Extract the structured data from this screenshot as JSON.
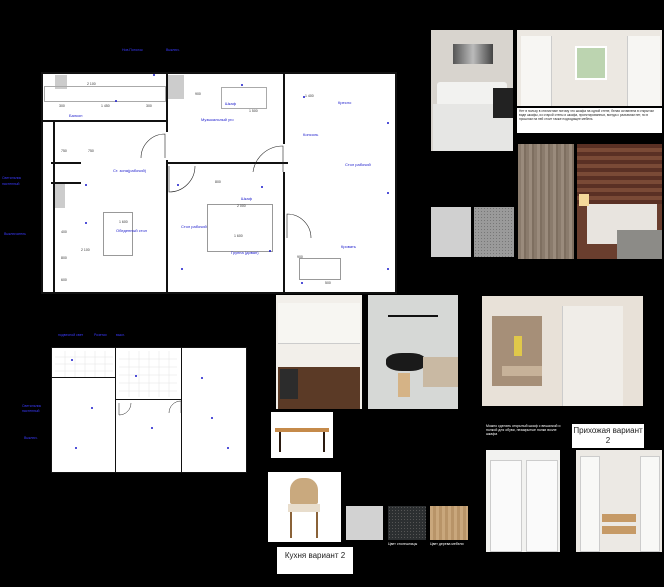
{
  "plan1": {
    "room_labels": {
      "balcony": "Балкон",
      "closet": "Шкаф",
      "music": "Музыкальный уго",
      "recliner": "Кресло",
      "console": "Консоль",
      "desk1": "Стол рабочий",
      "study_zone": "Ст. зона(рабочий)",
      "dining": "Обеденный стол",
      "desk2": "Стол рабочий",
      "bed": "Кровать",
      "sofa": "Группа (диван)",
      "shelf": "Шкаф"
    },
    "dims": [
      "300",
      "1 450",
      "300",
      "1 500",
      "750",
      "750",
      "1 600",
      "800",
      "2 100",
      "1 600",
      "2 000",
      "800",
      "1 400",
      "900",
      "500",
      "400",
      "600",
      "2 100",
      "900"
    ],
    "callouts": [
      "Нов.Потолок",
      "Выключ.",
      "Светильник",
      "настенный",
      "Выключатель"
    ]
  },
  "plan2": {
    "callouts": [
      "подвесной свет",
      "Розетки",
      "выкл.",
      "Светильник",
      "настенный",
      "Выключ."
    ]
  },
  "note_text": "Нет в пользу в стилистике потому что шкафа на одной стене, белая оставлена в открытом виде шкафы, из старой стены и шкафа, проектированных, всегда с разъемом нет, но в прошлом на ней стоит также подходящее мебель",
  "captions": {
    "hall": "Прихожая вариант 2",
    "kitchen": "Кухня вариант 2"
  },
  "swatch_labels": {
    "dark": "Цвет столешницы",
    "oak": "Цвет дерева мебели"
  },
  "hall_note": "Можно сделать открытый шкаф с вешалкой и полкой для обуви, незакрытые полки возле шкафа",
  "colors": {
    "background": "#000000",
    "plan_bg": "#ffffff",
    "label_blue": "#1a1acc",
    "wall": "#111111"
  }
}
